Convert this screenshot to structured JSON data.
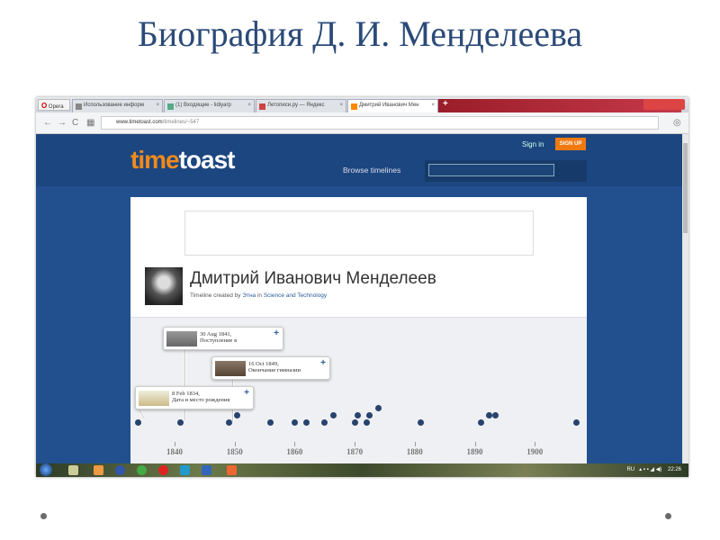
{
  "slide": {
    "title": "Биография Д. И. Менделеева"
  },
  "browser": {
    "app": "Opera",
    "tabs": [
      {
        "label": "Использование информ"
      },
      {
        "label": "(1) Входящие - lidiyarp"
      },
      {
        "label": "Летописи.ру — Яндекс"
      },
      {
        "label": "Дмитрий Иванович Мен"
      }
    ],
    "url_domain": "www.timetoast.com",
    "url_path": "/timelines/~547"
  },
  "site": {
    "logo_a": "time",
    "logo_b": "toast",
    "signin": "Sign in",
    "signup": "SIGN UP",
    "browse": "Browse timelines",
    "title": "Дмитрий Иванович Менделеев",
    "subtitle_prefix": "Timeline created by ",
    "author": "Этна",
    "subtitle_in": " in ",
    "category": "Science and Technology"
  },
  "timeline": {
    "axis_years": [
      1840,
      1850,
      1860,
      1870,
      1880,
      1890,
      1900
    ],
    "event_years": [
      1834,
      1841,
      1849,
      1850,
      1856,
      1860,
      1862,
      1865,
      1866,
      1870,
      1870,
      1872,
      1872,
      1873,
      1881,
      1891,
      1892,
      1893,
      1907
    ],
    "popups": [
      {
        "date": "30 Aug 1841,",
        "text": "Поступление в"
      },
      {
        "date": "16 Oct 1849,",
        "text": "Окончание гимназии"
      },
      {
        "date": "8 Feb 1834,",
        "text": "Дата и место рождения"
      }
    ]
  },
  "taskbar": {
    "lang": "RU",
    "time": "22:26"
  }
}
